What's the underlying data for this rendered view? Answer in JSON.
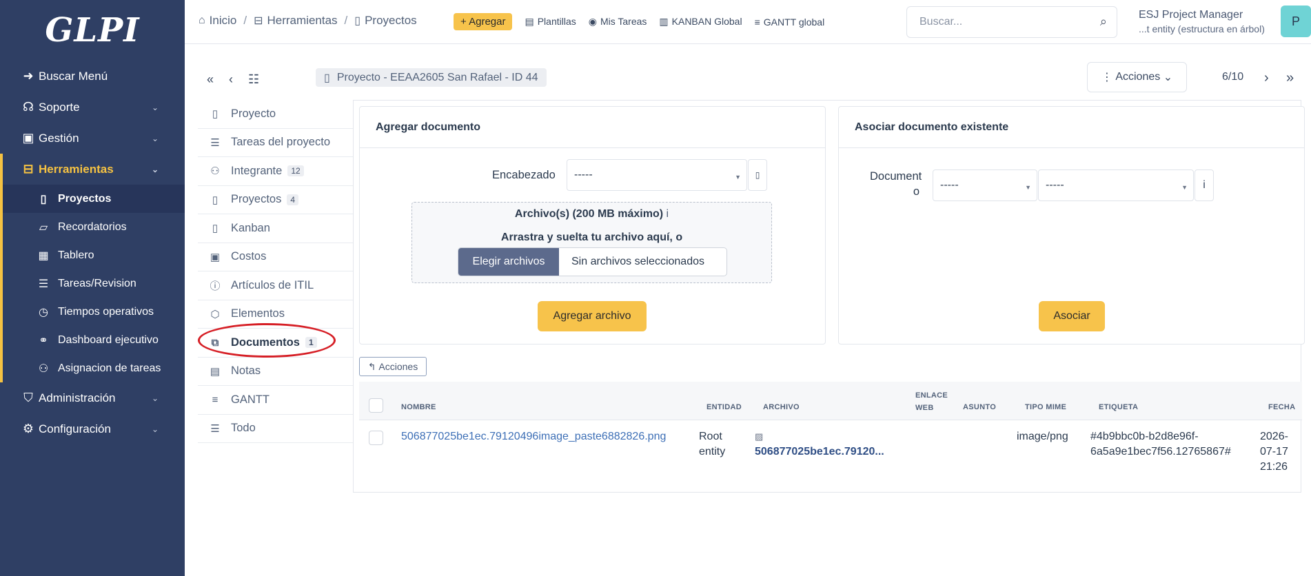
{
  "app": {
    "logo": "GLPI"
  },
  "sidebar": {
    "items": [
      {
        "label": "Buscar Menú",
        "icon": "arrow-right-icon"
      },
      {
        "label": "Soporte",
        "icon": "headset-icon"
      },
      {
        "label": "Gestión",
        "icon": "wallet-icon"
      },
      {
        "label": "Herramientas",
        "icon": "briefcase-icon"
      },
      {
        "label": "Administración",
        "icon": "shield-icon"
      },
      {
        "label": "Configuración",
        "icon": "gear-icon"
      }
    ],
    "submenu": [
      {
        "label": "Proyectos",
        "icon": "project-icon"
      },
      {
        "label": "Recordatorios",
        "icon": "note-icon"
      },
      {
        "label": "Tablero",
        "icon": "dashboard-icon"
      },
      {
        "label": "Tareas/Revision",
        "icon": "checklist-icon"
      },
      {
        "label": "Tiempos operativos",
        "icon": "clock-icon"
      },
      {
        "label": "Dashboard ejecutivo",
        "icon": "chart-icon"
      },
      {
        "label": "Asignacion de tareas",
        "icon": "users-icon"
      }
    ]
  },
  "header": {
    "breadcrumb": [
      "Inicio",
      "Herramientas",
      "Proyectos"
    ],
    "add_label": "Agregar",
    "actions": [
      "Plantillas",
      "Mis Tareas",
      "KANBAN Global",
      "GANTT global"
    ],
    "search_placeholder": "Buscar...",
    "user_name": "ESJ Project Manager",
    "user_entity": "...t entity (estructura en árbol)",
    "avatar_initial": "P"
  },
  "item": {
    "title": "Proyecto -  EEAA2605 San Rafael - ID 44",
    "actions_label": "Acciones",
    "pager": "6/10"
  },
  "tabs": [
    {
      "label": "Proyecto",
      "badge": ""
    },
    {
      "label": "Tareas del proyecto",
      "badge": ""
    },
    {
      "label": "Integrante",
      "badge": "12"
    },
    {
      "label": "Proyectos",
      "badge": "4"
    },
    {
      "label": "Kanban",
      "badge": ""
    },
    {
      "label": "Costos",
      "badge": ""
    },
    {
      "label": "Artículos de ITIL",
      "badge": ""
    },
    {
      "label": "Elementos",
      "badge": ""
    },
    {
      "label": "Documentos",
      "badge": "1"
    },
    {
      "label": "Notas",
      "badge": ""
    },
    {
      "label": "GANTT",
      "badge": ""
    },
    {
      "label": "Todo",
      "badge": ""
    }
  ],
  "add_doc": {
    "title": "Agregar documento",
    "heading_label": "Encabezado",
    "heading_value": "-----",
    "files_label": "Archivo(s) (200 MB máximo)",
    "info": "i",
    "drag_text": "Arrastra y suelta tu archivo aquí, o",
    "choose_label": "Elegir archivos",
    "no_files": "Sin archivos seleccionados",
    "submit": "Agregar archivo"
  },
  "assoc_doc": {
    "title": "Asociar documento existente",
    "doc_label_1": "Document",
    "doc_label_2": "o",
    "select1": "-----",
    "select2": "-----",
    "info": "i",
    "submit": "Asociar"
  },
  "table": {
    "actions_label": "Acciones",
    "headers": {
      "nombre": "NOMBRE",
      "entidad": "ENTIDAD",
      "archivo": "ARCHIVO",
      "enlace1": "ENLACE",
      "enlace2": "WEB",
      "asunto": "ASUNTO",
      "tipo": "TIPO MIME",
      "etiqueta": "ETIQUETA",
      "fecha": "FECHA"
    },
    "rows": [
      {
        "nombre": "506877025be1ec.79120496image_paste6882826.png",
        "entidad1": "Root",
        "entidad2": "entity",
        "archivo": "506877025be1ec.79120...",
        "tipo": "image/png",
        "etiqueta1": "#4b9bbc0b-b2d8e96f-",
        "etiqueta2": "6a5a9e1bec7f56.12765867#",
        "fecha1": "2026-",
        "fecha2": "07-17",
        "fecha3": "21:26"
      }
    ]
  }
}
